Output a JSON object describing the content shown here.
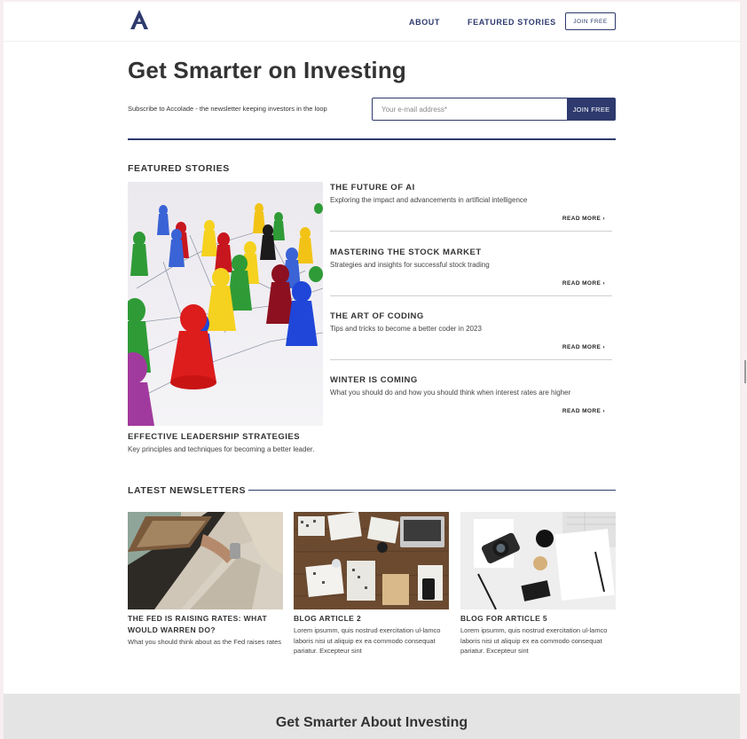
{
  "nav": {
    "about": "ABOUT",
    "featured": "FEATURED STORIES",
    "join": "JOIN FREE"
  },
  "hero": {
    "title": "Get Smarter on Investing",
    "subtitle": "Subscribe to Accolade - the newsletter keeping investors in the loop",
    "email_placeholder": "Your e-mail address*",
    "join": "JOIN FREE"
  },
  "featured": {
    "title": "FEATURED STORIES",
    "main": {
      "title": "EFFECTIVE LEADERSHIP STRATEGIES",
      "text": "Key principles and techniques for becoming a better leader."
    },
    "stories": [
      {
        "title": "THE FUTURE OF AI",
        "text": "Exploring the impact and advancements in artificial intelligence",
        "more": "READ MORE ›"
      },
      {
        "title": "MASTERING THE STOCK MARKET",
        "text": "Strategies and insights for successful stock trading",
        "more": "READ MORE ›"
      },
      {
        "title": "THE ART OF CODING",
        "text": "Tips and tricks to become a better coder in 2023",
        "more": "READ MORE ›"
      },
      {
        "title": "WINTER IS COMING",
        "text": "What you should do and how you should think when interest rates are higher",
        "more": "READ MORE ›"
      }
    ]
  },
  "latest": {
    "title": "LATEST NEWSLETTERS",
    "cards": [
      {
        "title": "THE FED IS RAISING RATES: WHAT WOULD WARREN DO?",
        "text": "What you should think about as the Fed raises rates"
      },
      {
        "title": "BLOG ARTICLE 2",
        "text": "Lorem ipsumm, quis nostrud exercitation ul-lamco laboris nisi ut aliquip ex ea commodo consequat pariatur. Excepteur sint"
      },
      {
        "title": "BLOG FOR ARTICLE 5",
        "text": "Lorem ipsumm, quis nostrud exercitation ul-lamco laboris nisi ut aliquip ex ea commodo consequat pariatur. Excepteur sint"
      }
    ]
  },
  "footer": {
    "title": "Get Smarter About Investing"
  },
  "colors": {
    "brand": "#2e3a6e",
    "footer_bg": "#e4e4e4"
  }
}
